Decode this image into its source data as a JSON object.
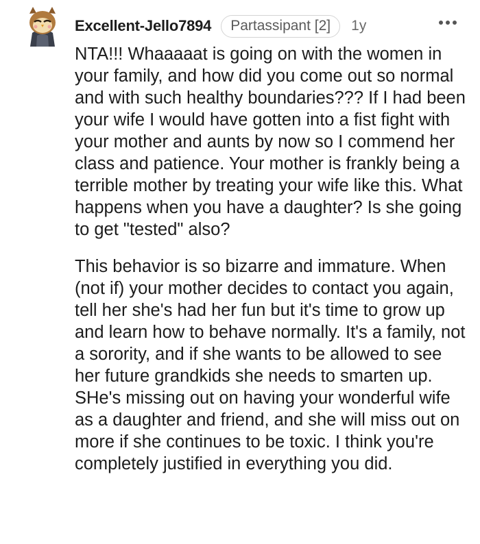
{
  "comment": {
    "author": "Excellent-Jello7894",
    "flair": "Partassipant [2]",
    "age": "1y",
    "paragraphs": [
      "NTA!!! Whaaaaat is going on with the women in your family, and how did you come out so normal and with such healthy boundaries??? If I had been your wife I would have gotten into a fist fight with your mother and aunts by now so I commend her class and patience. Your mother is frankly being a terrible mother by treating your wife like this. What happens when you have a daughter? Is she going to get \"tested\" also?",
      "This behavior is so bizarre and immature. When (not if) your mother decides to contact you again, tell her she's had her fun but it's time to grow up and learn how to behave normally. It's a family, not a sorority, and if she wants to be allowed to see her future grandkids she needs to smarten up. SHe's missing out on having your wonderful wife as a daughter and friend, and she will miss out on more if she continues to be toxic. I think you're completely justified in everything you did."
    ]
  },
  "icons": {
    "avatar": "owl-avatar-icon",
    "more": "more-options-icon"
  },
  "colors": {
    "text": "#1c1c1c",
    "muted": "#6a6a6a",
    "flair_border": "#d4d4d4"
  }
}
